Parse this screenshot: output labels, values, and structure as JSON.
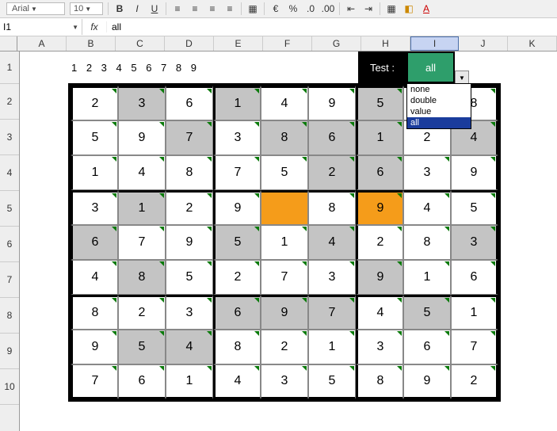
{
  "toolbar": {
    "font_name": "Arial",
    "font_size": "10"
  },
  "namebox": "I1",
  "fx_label": "fx",
  "formula_value": "all",
  "columns": [
    "A",
    "B",
    "C",
    "D",
    "E",
    "F",
    "G",
    "H",
    "I",
    "J",
    "K"
  ],
  "selected_column": "I",
  "row_headers": [
    "1",
    "2",
    "3",
    "4",
    "5",
    "6",
    "7",
    "8",
    "9",
    "10"
  ],
  "row1_digits": "1 2 3 4 5 6 7 8 9",
  "test_label": "Test :",
  "all_cell": "all",
  "dropdown": {
    "items": [
      "none",
      "double",
      "value",
      "all"
    ],
    "highlighted": "all"
  },
  "sudoku": {
    "values": [
      [
        "2",
        "3",
        "6",
        "1",
        "4",
        "9",
        "5",
        "",
        "8"
      ],
      [
        "5",
        "9",
        "7",
        "3",
        "8",
        "6",
        "1",
        "2",
        "4"
      ],
      [
        "1",
        "4",
        "8",
        "7",
        "5",
        "2",
        "6",
        "3",
        "9"
      ],
      [
        "3",
        "1",
        "2",
        "9",
        "",
        "8",
        "9",
        "4",
        "5"
      ],
      [
        "6",
        "7",
        "9",
        "5",
        "1",
        "4",
        "2",
        "8",
        "3"
      ],
      [
        "4",
        "8",
        "5",
        "2",
        "7",
        "3",
        "9",
        "1",
        "6"
      ],
      [
        "8",
        "2",
        "3",
        "6",
        "9",
        "7",
        "4",
        "5",
        "1"
      ],
      [
        "9",
        "5",
        "4",
        "8",
        "2",
        "1",
        "3",
        "6",
        "7"
      ],
      [
        "7",
        "6",
        "1",
        "4",
        "3",
        "5",
        "8",
        "9",
        "2"
      ]
    ],
    "gray": [
      [
        false,
        true,
        false,
        true,
        false,
        false,
        true,
        false,
        false
      ],
      [
        false,
        false,
        true,
        false,
        true,
        true,
        true,
        false,
        true
      ],
      [
        false,
        false,
        false,
        false,
        false,
        true,
        true,
        false,
        false
      ],
      [
        false,
        true,
        false,
        false,
        false,
        false,
        false,
        false,
        false
      ],
      [
        true,
        false,
        false,
        true,
        false,
        true,
        false,
        false,
        true
      ],
      [
        false,
        true,
        false,
        false,
        false,
        false,
        true,
        false,
        false
      ],
      [
        false,
        false,
        false,
        true,
        true,
        true,
        false,
        true,
        false
      ],
      [
        false,
        true,
        true,
        false,
        false,
        false,
        false,
        false,
        false
      ],
      [
        false,
        false,
        false,
        false,
        false,
        false,
        false,
        false,
        false
      ]
    ],
    "orange": [
      [
        false,
        false,
        false,
        false,
        false,
        false,
        false,
        false,
        false
      ],
      [
        false,
        false,
        false,
        false,
        false,
        false,
        false,
        false,
        false
      ],
      [
        false,
        false,
        false,
        false,
        false,
        false,
        false,
        false,
        false
      ],
      [
        false,
        false,
        false,
        false,
        true,
        false,
        true,
        false,
        false
      ],
      [
        false,
        false,
        false,
        false,
        false,
        false,
        false,
        false,
        false
      ],
      [
        false,
        false,
        false,
        false,
        false,
        false,
        false,
        false,
        false
      ],
      [
        false,
        false,
        false,
        false,
        false,
        false,
        false,
        false,
        false
      ],
      [
        false,
        false,
        false,
        false,
        false,
        false,
        false,
        false,
        false
      ],
      [
        false,
        false,
        false,
        false,
        false,
        false,
        false,
        false,
        false
      ]
    ]
  }
}
